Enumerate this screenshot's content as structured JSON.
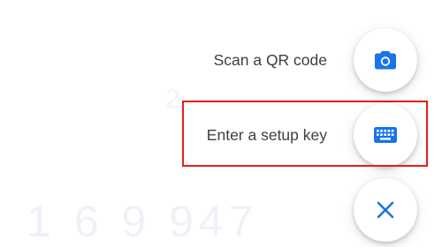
{
  "background": {
    "code_fragment": "1 6 9 947",
    "digit_fragment": "2"
  },
  "speed_dial": {
    "scan_label": "Scan a QR code",
    "scan_icon": "camera-icon",
    "setup_key_label": "Enter a setup key",
    "setup_key_icon": "keyboard-icon",
    "close_icon": "close-icon"
  },
  "colors": {
    "accent": "#1a73e8",
    "label_text": "#3c4043",
    "highlight": "#e81c1c"
  }
}
